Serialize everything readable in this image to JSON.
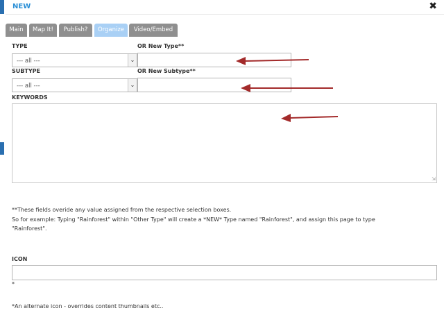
{
  "dialog": {
    "title": "NEW",
    "close_glyph": "✖"
  },
  "tabs": [
    {
      "label": "Main",
      "active": false
    },
    {
      "label": "Map It!",
      "active": false
    },
    {
      "label": "Publish?",
      "active": false
    },
    {
      "label": "Organize",
      "active": true
    },
    {
      "label": "Video/Embed",
      "active": false
    }
  ],
  "form": {
    "type_label": "TYPE",
    "type_value": "--- all ---",
    "new_type_label": "OR New Type**",
    "new_type_value": "",
    "subtype_label": "SUBTYPE",
    "subtype_value": "--- all ---",
    "new_subtype_label": "OR New Subtype**",
    "new_subtype_value": "",
    "keywords_label": "KEYWORDS",
    "keywords_value": "",
    "note_line1": "**These fields overide any value assigned from the respective selection boxes.",
    "note_line2": "So for example: Typing \"Rainforest\" within \"Other Type\" will create a *NEW* Type named \"Rainforest\", and assign this page to type",
    "note_line3": "\"Rainforest\".",
    "icon_label": "ICON",
    "icon_value": "",
    "icon_star": "*",
    "icon_note": "*An alternate icon - overrides content thumbnails etc.."
  },
  "colors": {
    "title": "#2a8fd6",
    "tab_inactive": "#8f8f8f",
    "tab_active": "#a9d0f5",
    "annotation_arrow": "#a32a2a"
  },
  "icons": {
    "close": "close-icon",
    "select_arrow": "chevron-down-icon"
  }
}
